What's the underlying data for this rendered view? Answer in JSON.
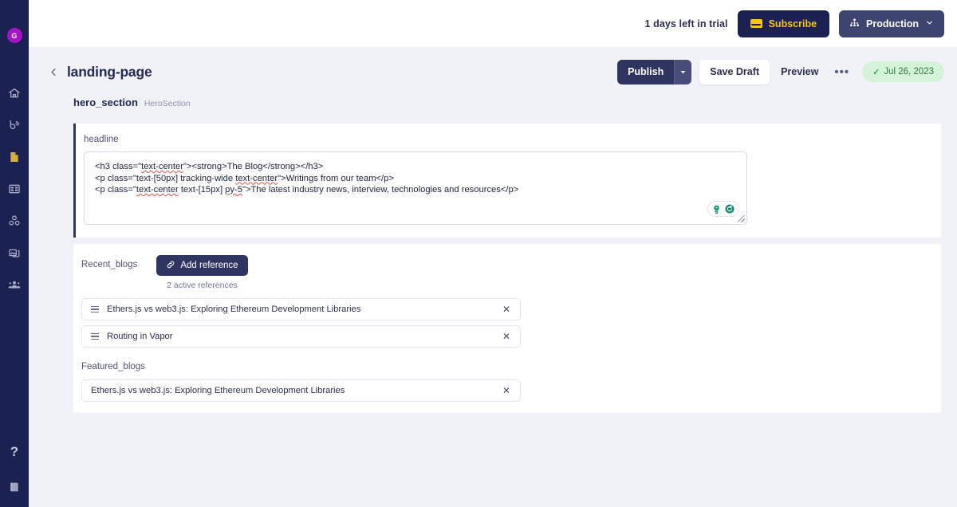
{
  "sidebar": {
    "avatar_initial": "G",
    "items": [
      {
        "name": "home-icon",
        "label": "Home",
        "active": false
      },
      {
        "name": "blog-icon",
        "label": "Blog",
        "active": false
      },
      {
        "name": "document-icon",
        "label": "Pages",
        "active": true
      },
      {
        "name": "table-icon",
        "label": "Collections",
        "active": false
      },
      {
        "name": "components-icon",
        "label": "Components",
        "active": false
      },
      {
        "name": "media-icon",
        "label": "Media",
        "active": false
      },
      {
        "name": "users-icon",
        "label": "Users",
        "active": false
      }
    ],
    "bottom": [
      {
        "name": "help-icon",
        "label": "?"
      },
      {
        "name": "book-icon",
        "label": "Docs"
      }
    ]
  },
  "topbar": {
    "trial_text": "1 days left in trial",
    "subscribe_label": "Subscribe",
    "environment_label": "Production"
  },
  "header": {
    "title": "landing-page",
    "back_label": "‹",
    "publish_label": "Publish",
    "save_draft_label": "Save Draft",
    "preview_label": "Preview",
    "more_label": "•••",
    "date_badge": "Jul 26, 2023",
    "check_glyph": "✓"
  },
  "section": {
    "name": "hero_section",
    "type": "HeroSection"
  },
  "hero": {
    "field_label": "headline",
    "code_lines": [
      "<h3 class=\"text-center\"><strong>The Blog</strong></h3>",
      "<p class=\"text-[50px] tracking-wide text-center\">Writings from our team</p>",
      "<p class=\"text-center text-[15px] py-5\">The latest industry news, interview, technologies and resources</p>"
    ]
  },
  "references": {
    "recent_label": "Recent_blogs",
    "add_reference_label": "Add reference",
    "active_references_label": "2 active references",
    "recent_items": [
      {
        "title": "Ethers.js vs web3.js: Exploring Ethereum Development Libraries",
        "close_label": "✕"
      },
      {
        "title": "Routing in Vapor",
        "close_label": "✕"
      }
    ],
    "featured_label": "Featured_blogs",
    "featured_items": [
      {
        "title": "Ethers.js vs web3.js: Exploring Ethereum Development Libraries",
        "close_label": "✕"
      }
    ]
  },
  "colors": {
    "sidebar_bg": "#1b2150",
    "page_bg": "#f1f2f7",
    "accent_dark": "#2f3560",
    "avatar_purple": "#a613c4",
    "subscribe_yellow": "#f5c518",
    "badge_green_bg": "#d5f3d9",
    "badge_green_text": "#2f7a47",
    "ai_green": "#0f9d7a",
    "active_nav_yellow": "#d6b13a"
  }
}
